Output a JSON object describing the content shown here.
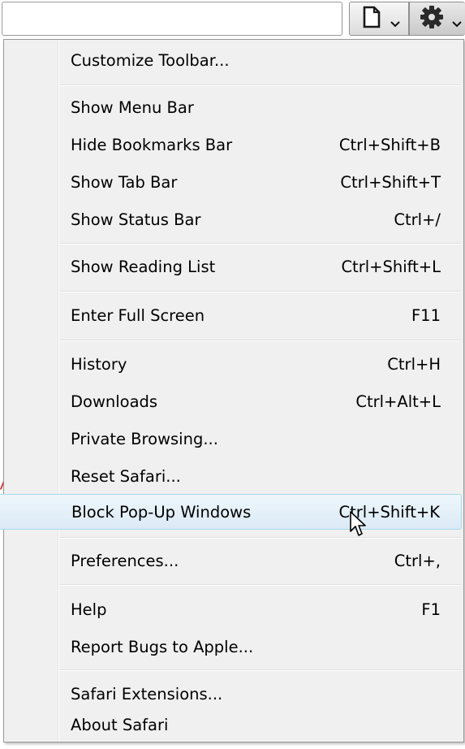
{
  "menu": {
    "items": [
      {
        "label": "Customize Toolbar...",
        "shortcut": ""
      },
      {
        "label": "Show Menu Bar",
        "shortcut": ""
      },
      {
        "label": "Hide Bookmarks Bar",
        "shortcut": "Ctrl+Shift+B"
      },
      {
        "label": "Show Tab Bar",
        "shortcut": "Ctrl+Shift+T"
      },
      {
        "label": "Show Status Bar",
        "shortcut": "Ctrl+/"
      },
      {
        "label": "Show Reading List",
        "shortcut": "Ctrl+Shift+L"
      },
      {
        "label": "Enter Full Screen",
        "shortcut": "F11"
      },
      {
        "label": "History",
        "shortcut": "Ctrl+H"
      },
      {
        "label": "Downloads",
        "shortcut": "Ctrl+Alt+L"
      },
      {
        "label": "Private Browsing...",
        "shortcut": ""
      },
      {
        "label": "Reset Safari...",
        "shortcut": ""
      },
      {
        "label": "Block Pop-Up Windows",
        "shortcut": "Ctrl+Shift+K"
      },
      {
        "label": "Preferences...",
        "shortcut": "Ctrl+,"
      },
      {
        "label": "Help",
        "shortcut": "F1"
      },
      {
        "label": "Report Bugs to Apple...",
        "shortcut": ""
      },
      {
        "label": "Safari Extensions...",
        "shortcut": ""
      },
      {
        "label": "About Safari",
        "shortcut": ""
      }
    ],
    "highlighted_item": "Block Pop-Up Windows"
  },
  "toolbar": {
    "page_icon": "page-menu-icon",
    "gear_icon": "gear-icon"
  },
  "colors": {
    "menu_bg": "#f0f0f0",
    "highlight_border": "#a8d8eb",
    "highlight_bg": "#dbeaf6",
    "mark_red": "#d62020"
  }
}
